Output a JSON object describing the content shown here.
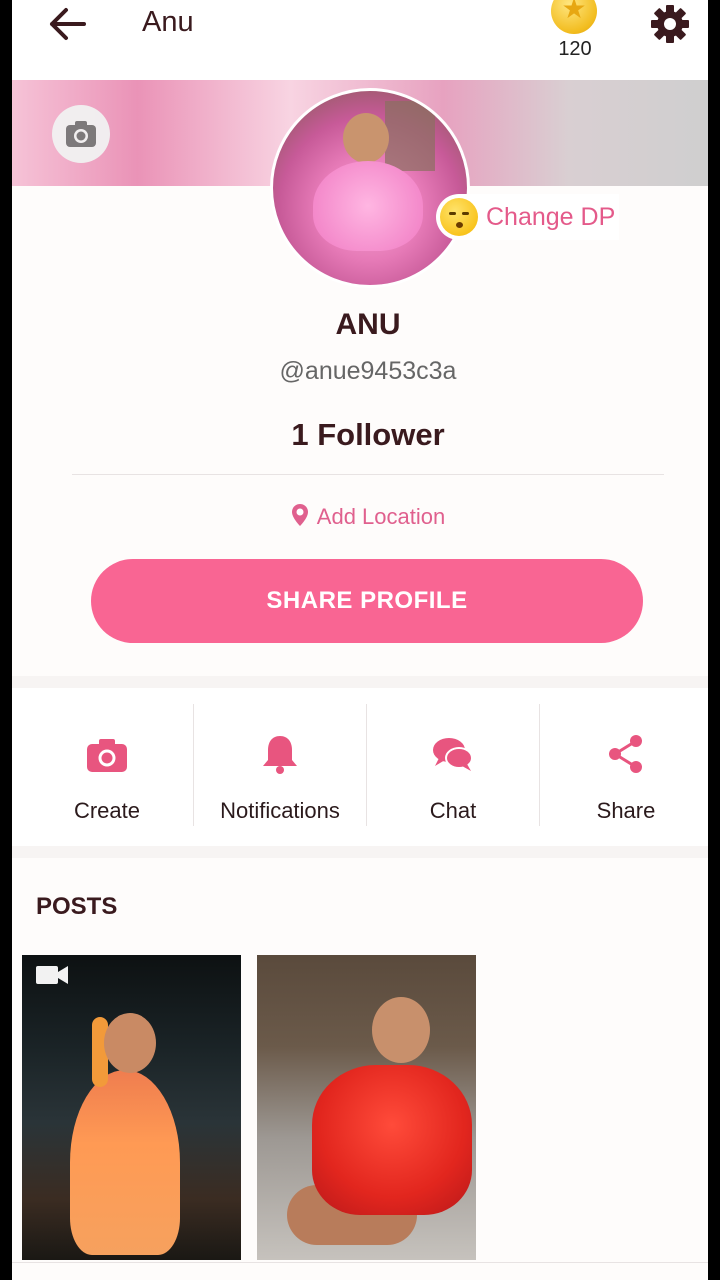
{
  "header": {
    "title": "Anu",
    "coins": "120"
  },
  "profile": {
    "change_dp_label": "Change DP",
    "display_name": "ANU",
    "handle": "@anue9453c3a",
    "followers": "1 Follower",
    "location_label": "Add Location",
    "share_button": "SHARE PROFILE"
  },
  "actions": [
    {
      "label": "Create",
      "icon": "camera-icon"
    },
    {
      "label": "Notifications",
      "icon": "bell-icon"
    },
    {
      "label": "Chat",
      "icon": "chat-bubbles-icon"
    },
    {
      "label": "Share",
      "icon": "share-icon"
    }
  ],
  "posts": {
    "title": "POSTS",
    "items": [
      {
        "type": "video"
      },
      {
        "type": "photo"
      }
    ]
  },
  "colors": {
    "accent": "#f96593",
    "accent_text": "#e45a8a",
    "icon": "#e8557f",
    "dark_text": "#3a1a1e"
  }
}
